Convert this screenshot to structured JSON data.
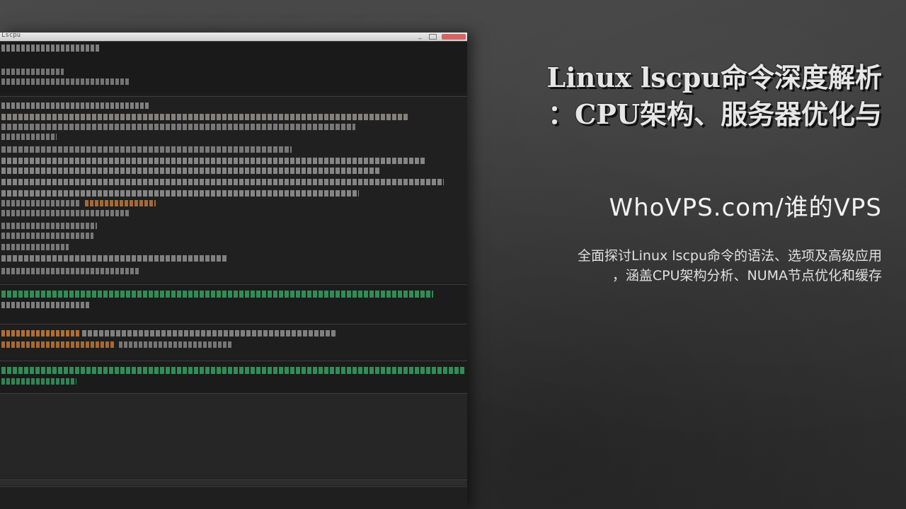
{
  "terminal": {
    "title": "Lscpu"
  },
  "headline": {
    "line1": "Linux lscpu命令深度解析",
    "line2": "：CPU架构、服务器优化与"
  },
  "site": "WhoVPS.com/谁的VPS",
  "description": {
    "line1": "全面探讨Linux lscpu命令的语法、选项及高级应用",
    "line2": "，涵盖CPU架构分析、NUMA节点优化和缓存"
  },
  "colors": {
    "background": "#3f3f3f",
    "terminal_bg": "#1d1d1d",
    "terminal_text": "#d8d8d8",
    "terminal_green": "#37b36a",
    "terminal_orange": "#e08a3c",
    "headline_text": "#e6e6e6"
  }
}
